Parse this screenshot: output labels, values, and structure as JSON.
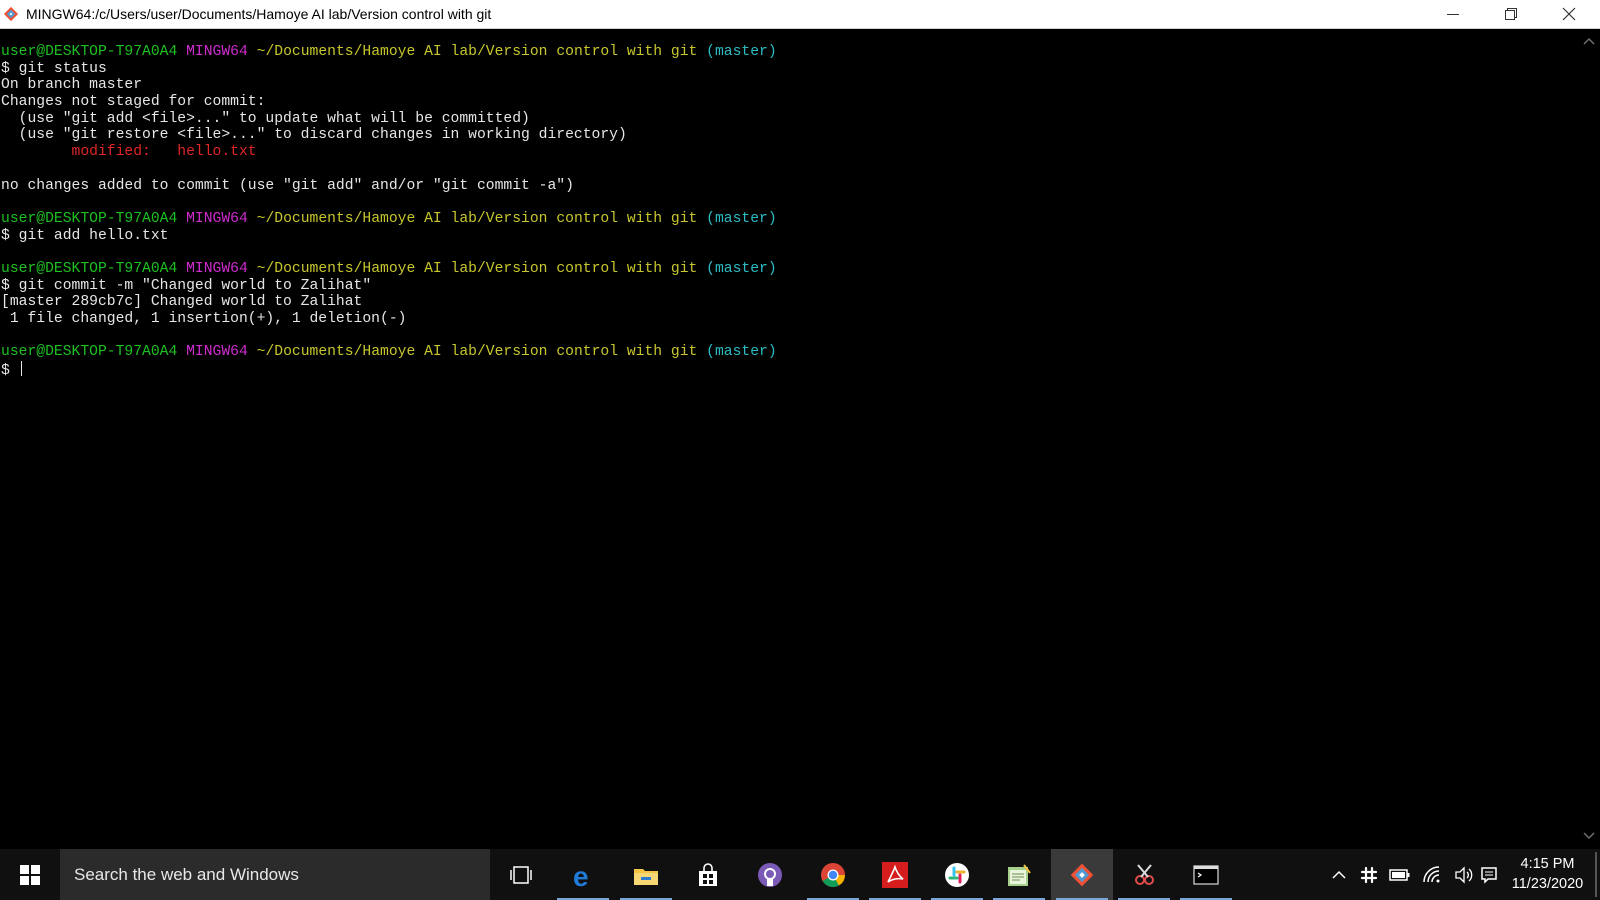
{
  "window": {
    "title": "MINGW64:/c/Users/user/Documents/Hamoye AI lab/Version control with git"
  },
  "prompt": {
    "user": "user@DESKTOP-T97A0A4",
    "system": "MINGW64",
    "path": "~/Documents/Hamoye AI lab/Version control with git",
    "branch": "(master)"
  },
  "terminal": {
    "lines": [
      {
        "type": "prompt"
      },
      {
        "type": "text",
        "text": "$ git status"
      },
      {
        "type": "text",
        "text": "On branch master"
      },
      {
        "type": "text",
        "text": "Changes not staged for commit:"
      },
      {
        "type": "text",
        "text": "  (use \"git add <file>...\" to update what will be committed)"
      },
      {
        "type": "text",
        "text": "  (use \"git restore <file>...\" to discard changes in working directory)"
      },
      {
        "type": "red",
        "text": "        modified:   hello.txt"
      },
      {
        "type": "blank"
      },
      {
        "type": "text",
        "text": "no changes added to commit (use \"git add\" and/or \"git commit -a\")"
      },
      {
        "type": "blank"
      },
      {
        "type": "prompt"
      },
      {
        "type": "text",
        "text": "$ git add hello.txt"
      },
      {
        "type": "blank"
      },
      {
        "type": "prompt"
      },
      {
        "type": "text",
        "text": "$ git commit -m \"Changed world to Zalihat\""
      },
      {
        "type": "text",
        "text": "[master 289cb7c] Changed world to Zalihat"
      },
      {
        "type": "text",
        "text": " 1 file changed, 1 insertion(+), 1 deletion(-)"
      },
      {
        "type": "blank"
      },
      {
        "type": "prompt"
      },
      {
        "type": "input",
        "text": "$ "
      }
    ]
  },
  "taskbar": {
    "search_placeholder": "Search the web and Windows",
    "apps": [
      {
        "icon": "task-view-icon",
        "underline": false,
        "active": false
      },
      {
        "icon": "edge-icon",
        "underline": true,
        "active": false
      },
      {
        "icon": "file-explorer-icon",
        "underline": true,
        "active": false
      },
      {
        "icon": "store-icon",
        "underline": false,
        "active": false
      },
      {
        "icon": "github-icon",
        "underline": false,
        "active": false
      },
      {
        "icon": "chrome-icon",
        "underline": true,
        "active": false
      },
      {
        "icon": "acrobat-icon",
        "underline": true,
        "active": false
      },
      {
        "icon": "slack-icon",
        "underline": true,
        "active": false
      },
      {
        "icon": "notepad-icon",
        "underline": true,
        "active": false
      },
      {
        "icon": "git-bash-icon",
        "underline": true,
        "active": true
      },
      {
        "icon": "snipping-tool-icon",
        "underline": true,
        "active": false
      },
      {
        "icon": "terminal-icon",
        "underline": true,
        "active": false
      }
    ],
    "clock_time": "4:15 PM",
    "clock_date": "11/23/2020"
  }
}
